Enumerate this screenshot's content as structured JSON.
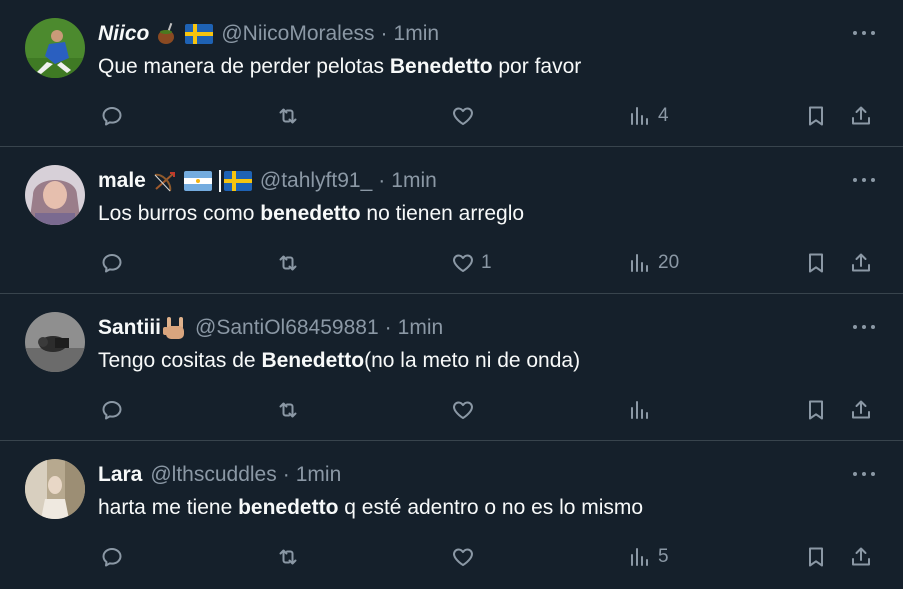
{
  "tweets": [
    {
      "name": "Niico",
      "emojis": [
        "mate",
        "flag-sweden"
      ],
      "handle": "@NiicoMoraless",
      "time": "1min",
      "text_before": "Que manera de perder pelotas ",
      "text_bold": "Benedetto",
      "text_after": " por favor",
      "reply_count": "",
      "retweet_count": "",
      "like_count": "",
      "view_count": "4"
    },
    {
      "name": "male",
      "emojis": [
        "bow-and-arrow",
        "flag-argentina",
        "divider",
        "flag-sweden"
      ],
      "handle": "@tahlyft91_",
      "time": "1min",
      "text_before": "Los burros como ",
      "text_bold": "benedetto",
      "text_after": " no tienen arreglo",
      "reply_count": "",
      "retweet_count": "",
      "like_count": "1",
      "view_count": "20"
    },
    {
      "name": "Santiii",
      "emojis": [
        "sign-of-horns"
      ],
      "handle": "@SantiOl68459881",
      "time": "1min",
      "text_before": "Tengo cositas de ",
      "text_bold": "Benedetto",
      "text_after": "(no la meto ni de onda)",
      "reply_count": "",
      "retweet_count": "",
      "like_count": "",
      "view_count": ""
    },
    {
      "name": "Lara",
      "emojis": [],
      "handle": "@lthscuddles",
      "time": "1min",
      "text_before": "harta me tiene ",
      "text_bold": "benedetto",
      "text_after": " q esté adentro o no es lo mismo",
      "reply_count": "",
      "retweet_count": "",
      "like_count": "",
      "view_count": "5"
    }
  ],
  "separator": "·",
  "colors": {
    "background": "#15202b",
    "text": "#f7f9f9",
    "muted": "#8b98a5",
    "border": "#38444d"
  }
}
